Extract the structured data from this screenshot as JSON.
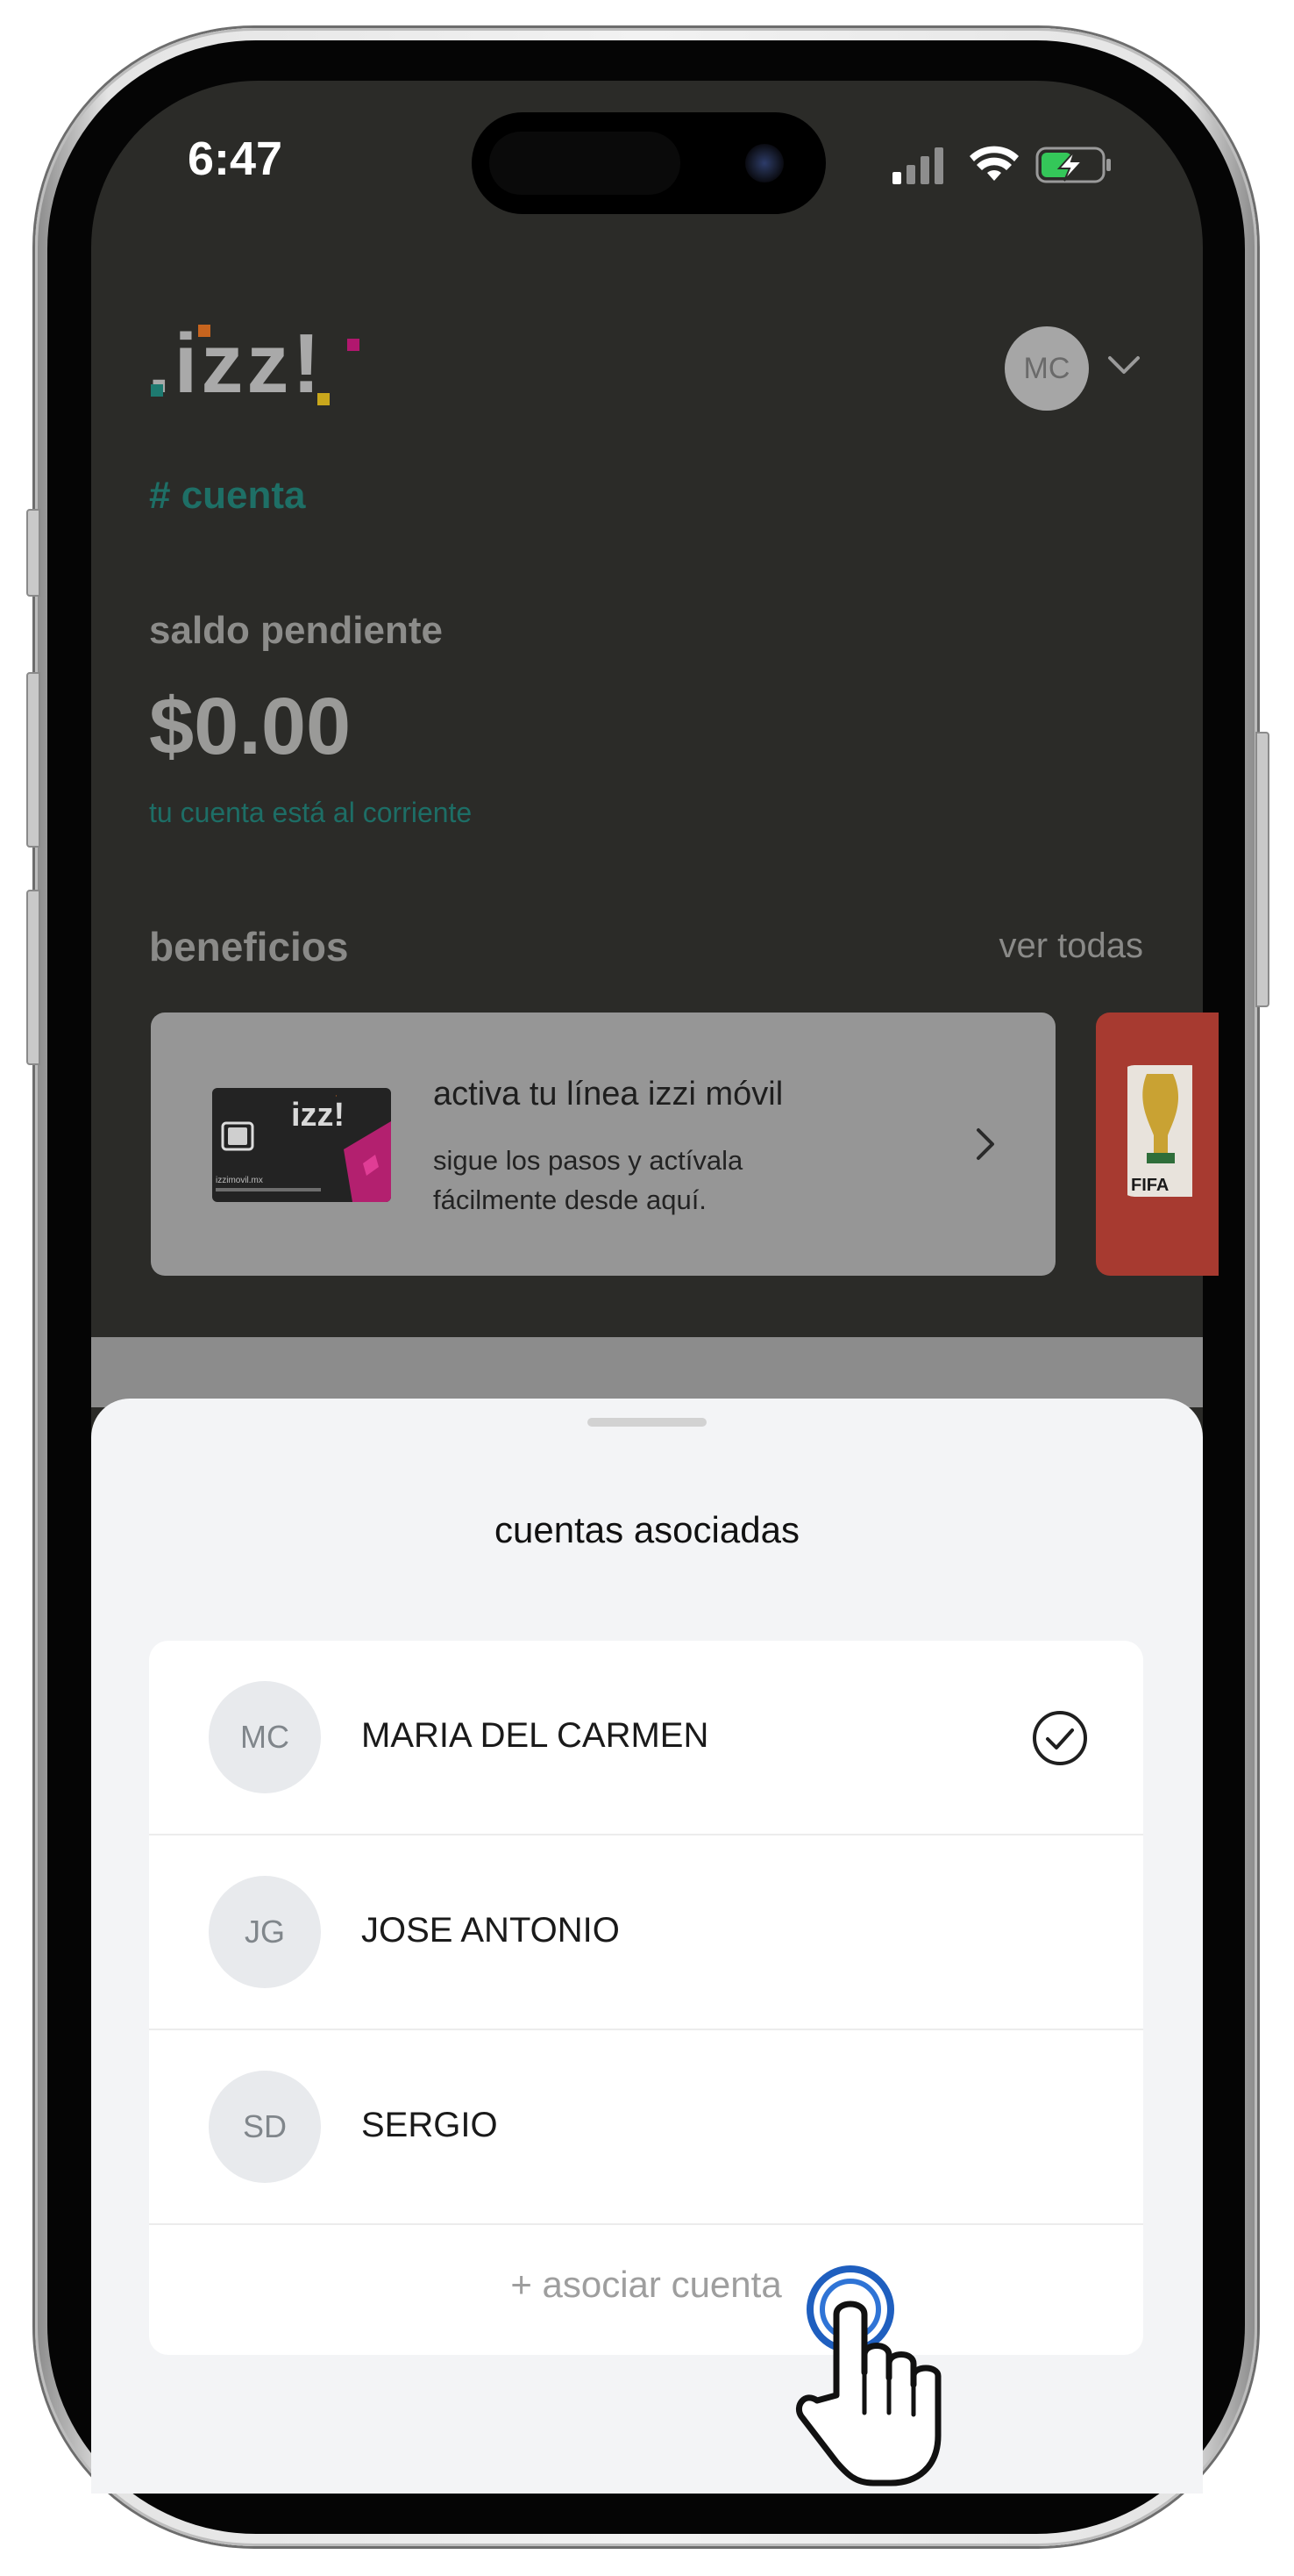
{
  "status_bar": {
    "time": "6:47",
    "icons": [
      "cellular-signal-icon",
      "wifi-icon",
      "battery-charging-icon"
    ],
    "battery_color": "#34c759"
  },
  "header": {
    "logo_text": ".izz!",
    "avatar_initials": "MC",
    "chevron_icon": "chevron-down-icon"
  },
  "section": {
    "tag": "# cuenta"
  },
  "balance": {
    "label": "saldo pendiente",
    "amount": "$0.00",
    "status": "tu cuenta está al corriente"
  },
  "benefits": {
    "title": "beneficios",
    "see_all": "ver todas",
    "cards": [
      {
        "title": "activa tu línea izzi móvil",
        "description": "sigue los pasos y actívala fácilmente desde aquí.",
        "sim_logo": "izz!",
        "sim_small_text": "izzimovil.mx",
        "chevron_icon": "chevron-right-icon"
      },
      {
        "label": "FIFA",
        "icon": "world-cup-trophy-icon"
      }
    ]
  },
  "sheet": {
    "title": "cuentas asociadas",
    "accounts": [
      {
        "initials": "MC",
        "name": "MARIA DEL CARMEN",
        "selected": true
      },
      {
        "initials": "JG",
        "name": "JOSE ANTONIO",
        "selected": false
      },
      {
        "initials": "SD",
        "name": "SERGIO",
        "selected": false
      }
    ],
    "add_account": "+ asociar cuenta"
  },
  "colors": {
    "brand_teal": "#1e6f66",
    "dim_background": "#2b2b28",
    "sheet_background": "#f3f4f6",
    "tap_indicator": "#1f5fbf"
  }
}
